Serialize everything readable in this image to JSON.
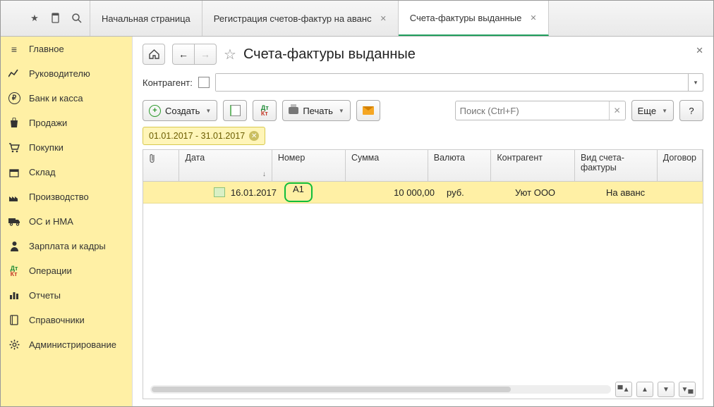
{
  "tabs": {
    "home": "Начальная страница",
    "reg": "Регистрация счетов-фактур на аванс",
    "out": "Счета-фактуры выданные"
  },
  "sidebar": {
    "items": [
      {
        "label": "Главное",
        "icon": "menu"
      },
      {
        "label": "Руководителю",
        "icon": "chart"
      },
      {
        "label": "Банк и касса",
        "icon": "ruble"
      },
      {
        "label": "Продажи",
        "icon": "bag"
      },
      {
        "label": "Покупки",
        "icon": "cart"
      },
      {
        "label": "Склад",
        "icon": "box"
      },
      {
        "label": "Производство",
        "icon": "factory"
      },
      {
        "label": "ОС и НМА",
        "icon": "truck"
      },
      {
        "label": "Зарплата и кадры",
        "icon": "person"
      },
      {
        "label": "Операции",
        "icon": "dtkt"
      },
      {
        "label": "Отчеты",
        "icon": "bars"
      },
      {
        "label": "Справочники",
        "icon": "book"
      },
      {
        "label": "Администрирование",
        "icon": "gear"
      }
    ]
  },
  "page": {
    "title": "Счета-фактуры выданные",
    "filter_label": "Контрагент:",
    "date_range": "01.01.2017 - 31.01.2017"
  },
  "toolbar": {
    "create": "Создать",
    "print": "Печать",
    "more": "Еще",
    "help": "?",
    "search_placeholder": "Поиск (Ctrl+F)"
  },
  "table": {
    "cols": {
      "date": "Дата",
      "num": "Номер",
      "sum": "Сумма",
      "cur": "Валюта",
      "agent": "Контрагент",
      "kind": "Вид счета-фактуры",
      "contract": "Договор"
    },
    "rows": [
      {
        "date": "16.01.2017",
        "num": "А1",
        "sum": "10 000,00",
        "cur": "руб.",
        "agent": "Уют ООО",
        "kind": "На аванс",
        "contract": ""
      }
    ]
  }
}
